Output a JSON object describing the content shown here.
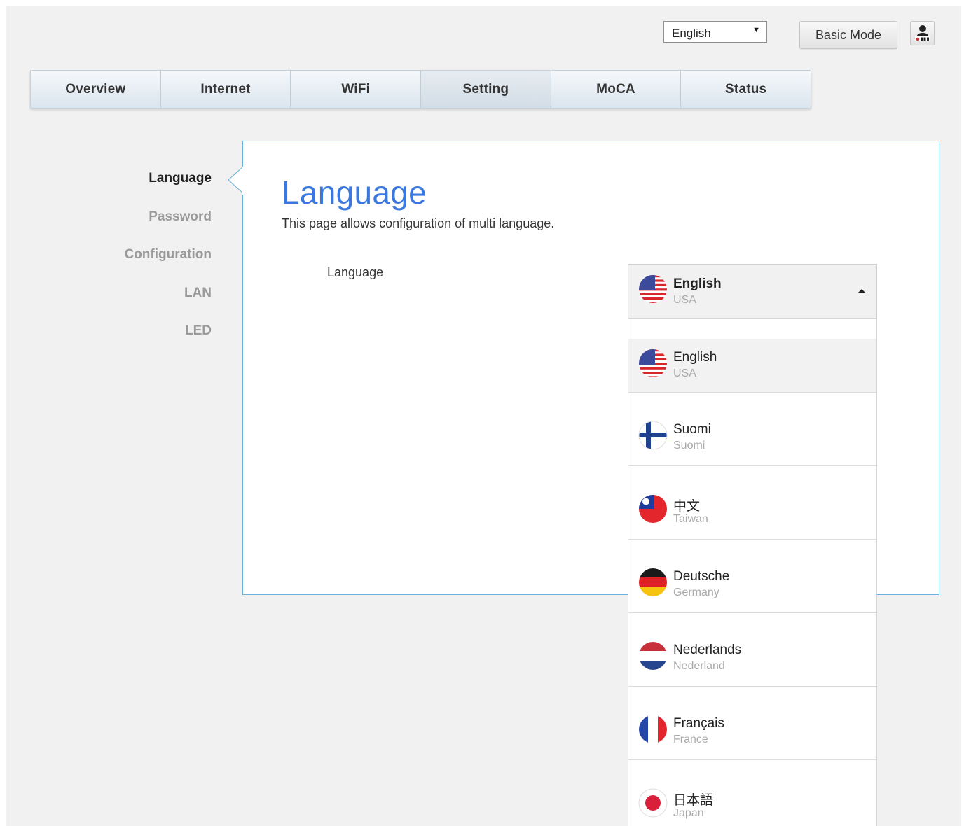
{
  "header": {
    "language_select": "English",
    "basic_mode_label": "Basic Mode"
  },
  "tabs": [
    {
      "label": "Overview"
    },
    {
      "label": "Internet"
    },
    {
      "label": "WiFi"
    },
    {
      "label": "Setting"
    },
    {
      "label": "MoCA"
    },
    {
      "label": "Status"
    }
  ],
  "active_tab": "Setting",
  "side_nav": [
    {
      "label": "Language"
    },
    {
      "label": "Password"
    },
    {
      "label": "Configuration"
    },
    {
      "label": "LAN"
    },
    {
      "label": "LED"
    }
  ],
  "panel": {
    "title": "Language",
    "description": "This page allows configuration of multi language.",
    "field_label": "Language"
  },
  "dropdown": {
    "selected": {
      "name": "English",
      "sub": "USA",
      "flag": "usa-flag-icon"
    },
    "options": [
      {
        "name": "English",
        "sub": "USA",
        "flag": "usa-flag-icon"
      },
      {
        "name": "Suomi",
        "sub": "Suomi",
        "flag": "finland-flag-icon"
      },
      {
        "name": "中文",
        "sub": "Taiwan",
        "flag": "taiwan-flag-icon"
      },
      {
        "name": "Deutsche",
        "sub": "Germany",
        "flag": "germany-flag-icon"
      },
      {
        "name": "Nederlands",
        "sub": "Nederland",
        "flag": "netherlands-flag-icon"
      },
      {
        "name": "Français",
        "sub": "France",
        "flag": "france-flag-icon"
      },
      {
        "name": "日本語",
        "sub": "Japan",
        "flag": "japan-flag-icon"
      }
    ]
  },
  "colors": {
    "accent": "#3a78e0",
    "panel_border": "#6ab1da",
    "page_bg": "#f1f1f1"
  }
}
